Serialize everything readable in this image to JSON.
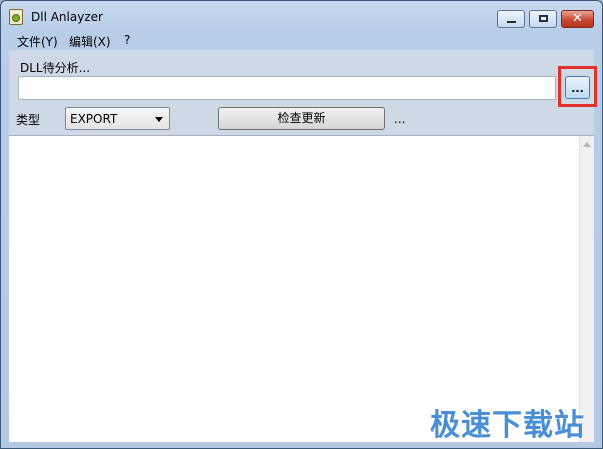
{
  "window": {
    "title": "Dll Anlayzer"
  },
  "titlebar": {
    "close_glyph": "✕"
  },
  "menu": [
    "文件(Y)",
    "编辑(X)",
    "?"
  ],
  "path": {
    "label": "DLL待分析...",
    "value": "",
    "browse_label": "..."
  },
  "controls": {
    "type_label": "类型",
    "type_value": "EXPORT",
    "check_button_label": "检查更新",
    "status_text": "..."
  },
  "watermark": "极速下载站",
  "colors": {
    "highlight": "#e0322c",
    "accent": "#4a8ed6"
  }
}
